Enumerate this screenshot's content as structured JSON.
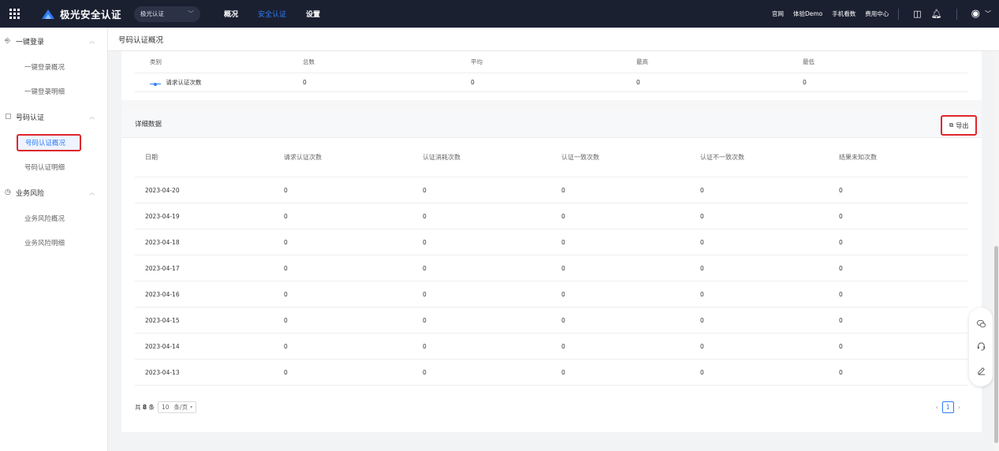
{
  "topbar": {
    "brand": "极光安全认证",
    "product_select": "极光认证",
    "nav": [
      {
        "label": "概况",
        "active": false
      },
      {
        "label": "安全认证",
        "active": true
      },
      {
        "label": "设置",
        "active": false
      }
    ],
    "right_links": [
      "官网",
      "体验Demo",
      "手机看数",
      "费用中心"
    ],
    "icons": [
      "apps-grid-icon",
      "layout-icon",
      "bell-icon",
      "user-avatar-icon"
    ],
    "accent_color": "#2f7cf6",
    "bg_color": "#1b2031"
  },
  "sidebar": {
    "groups": [
      {
        "icon": "login-icon",
        "label": "一键登录",
        "items": [
          "一键登录概况",
          "一键登录明细"
        ]
      },
      {
        "icon": "phone-verify-icon",
        "label": "号码认证",
        "items": [
          "号码认证概况",
          "号码认证明细"
        ],
        "active_item": "号码认证概况"
      },
      {
        "icon": "risk-icon",
        "label": "业务风险",
        "items": [
          "业务风险概况",
          "业务风险明细"
        ]
      }
    ]
  },
  "page": {
    "breadcrumb": "号码认证概况"
  },
  "summary": {
    "headers": [
      "类别",
      "总数",
      "平均",
      "最高",
      "最低"
    ],
    "rows": [
      {
        "series": "请求认证次数",
        "total": "0",
        "avg": "0",
        "max": "0",
        "min": "0"
      }
    ]
  },
  "detail": {
    "title": "详细数据",
    "export_label": "导出",
    "headers": [
      "日期",
      "请求认证次数",
      "认证消耗次数",
      "认证一致次数",
      "认证不一致次数",
      "结果未知次数"
    ],
    "rows": [
      [
        "2023-04-20",
        "0",
        "0",
        "0",
        "0",
        "0"
      ],
      [
        "2023-04-19",
        "0",
        "0",
        "0",
        "0",
        "0"
      ],
      [
        "2023-04-18",
        "0",
        "0",
        "0",
        "0",
        "0"
      ],
      [
        "2023-04-17",
        "0",
        "0",
        "0",
        "0",
        "0"
      ],
      [
        "2023-04-16",
        "0",
        "0",
        "0",
        "0",
        "0"
      ],
      [
        "2023-04-15",
        "0",
        "0",
        "0",
        "0",
        "0"
      ],
      [
        "2023-04-14",
        "0",
        "0",
        "0",
        "0",
        "0"
      ],
      [
        "2023-04-13",
        "0",
        "0",
        "0",
        "0",
        "0"
      ]
    ]
  },
  "pagination": {
    "total_prefix": "共",
    "total_count": "8",
    "total_suffix": "条",
    "page_size": "10",
    "page_size_unit": "条/页",
    "current_page": "1"
  },
  "highlight_color": "#e0262d"
}
